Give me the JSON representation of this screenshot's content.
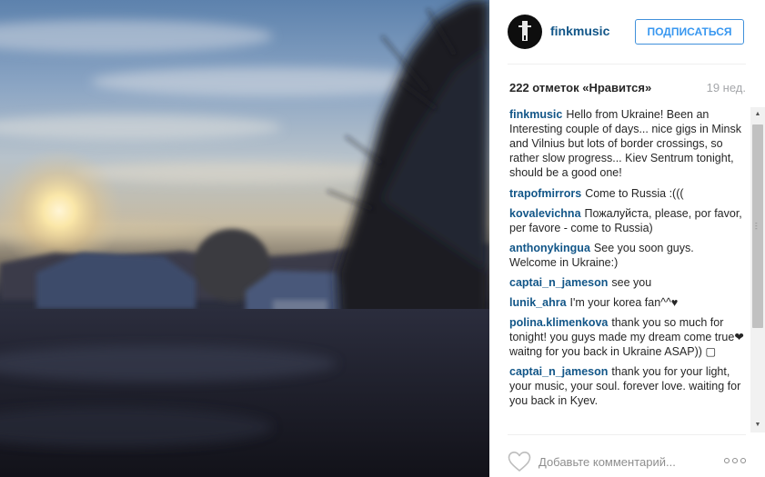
{
  "post": {
    "photo_icon": "sunset-countryside-photo",
    "author": {
      "username": "finkmusic",
      "avatar_icon": "fink-logo-avatar"
    },
    "follow_label": "ПОДПИСАТЬСЯ",
    "likes_text": "222 отметок «Нравится»",
    "age_text": "19 нед.",
    "comments": [
      {
        "user": "finkmusic",
        "text": "Hello from Ukraine! Been an Interesting couple of days... nice gigs in Minsk and Vilnius but lots of border crossings, so rather slow progress... Kiev Sentrum tonight, should be a good one!"
      },
      {
        "user": "trapofmirrors",
        "text": "Come to Russia :((("
      },
      {
        "user": "kovalevichna",
        "text": "Пожалуйста, please, por favor, per favore - come to Russia)"
      },
      {
        "user": "anthonykingua",
        "text": "See you soon guys. Welcome in Ukraine:)"
      },
      {
        "user": "captai_n_jameson",
        "text": "see you"
      },
      {
        "user": "lunik_ahra",
        "text": "I'm your korea fan^^♥"
      },
      {
        "user": "polina.klimenkova",
        "text": "thank you so much for tonight! you guys made my dream come true❤ waitng for you back in Ukraine ASAP)) ▢"
      },
      {
        "user": "captai_n_jameson",
        "text": "thank you for your light, your music, your soul. forever love. waiting for you back in Kyev."
      }
    ],
    "comment_placeholder": "Добавьте комментарий...",
    "like_icon": "heart-outline-icon",
    "more_icon": "more-options-icon",
    "colors": {
      "username_blue": "#125688",
      "follow_blue": "#3897f0",
      "muted_grey": "#a5a7aa"
    }
  }
}
